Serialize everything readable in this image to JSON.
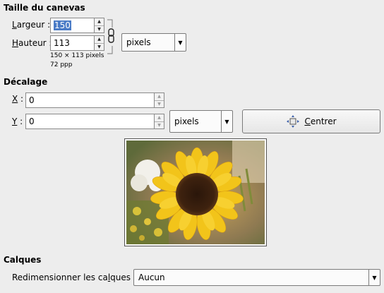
{
  "canvas_size": {
    "title": "Taille du canevas",
    "width_label_underline": "L",
    "width_label_rest": "argeur :",
    "width_value": "150",
    "height_label_underline": "H",
    "height_label_rest": "auteur :",
    "height_value": "113",
    "dims_text": "150 × 113 pixels",
    "resolution_text": "72 ppp",
    "unit": "pixels"
  },
  "offset": {
    "title": "Décalage",
    "x_label": "X",
    "x_value": "0",
    "y_label": "Y",
    "y_value": "0",
    "unit": "pixels",
    "center_button_label_underline": "C",
    "center_button_label_rest": "entrer"
  },
  "layers": {
    "title": "Calques",
    "resize_label_prefix": "Redimensionner les ca",
    "resize_label_underline": "l",
    "resize_label_suffix": "ques :",
    "resize_value": "Aucun"
  },
  "icons": [
    "chain-link-icon",
    "center-icon",
    "spin-up-icon",
    "spin-down-icon",
    "dropdown-arrow-icon"
  ]
}
